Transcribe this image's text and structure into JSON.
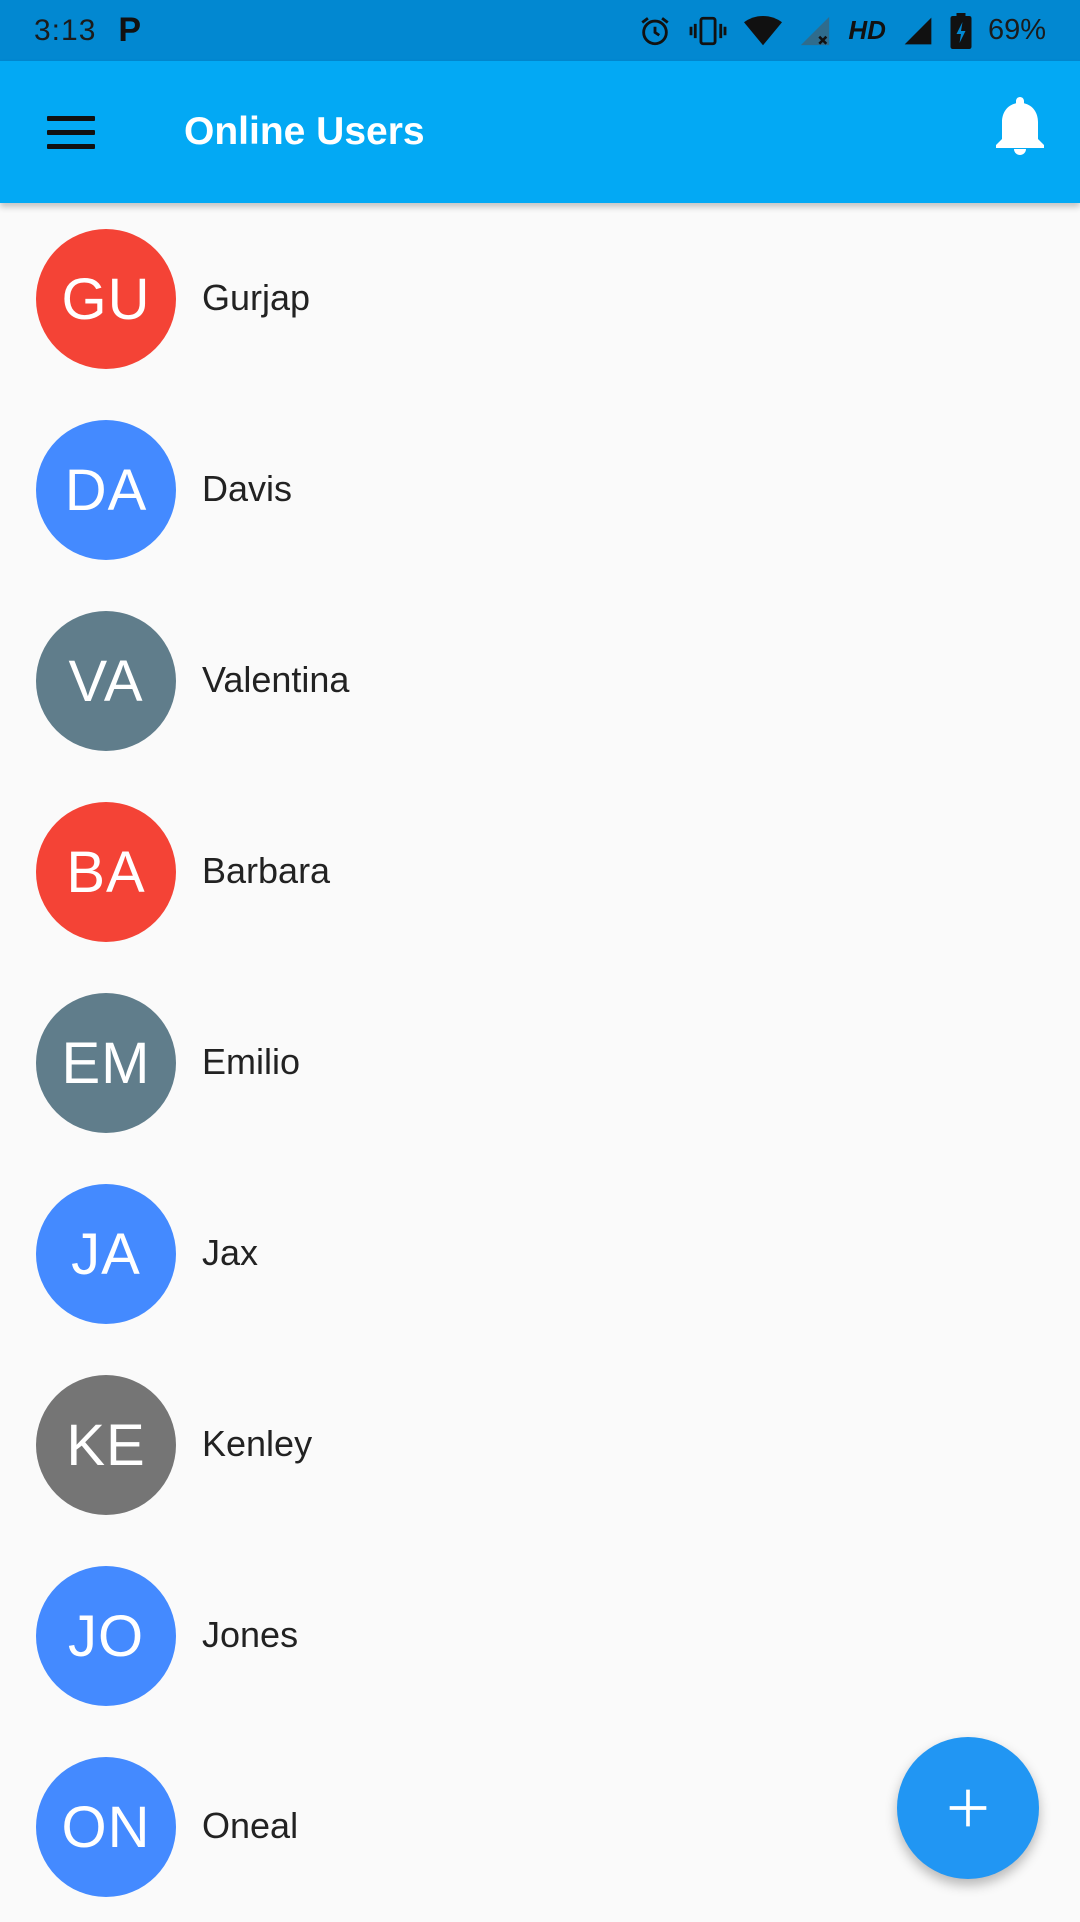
{
  "status_bar": {
    "time": "3:13",
    "notification_letter": "P",
    "network_label": "HD",
    "battery_text": "69%",
    "icons": [
      "alarm-icon",
      "vibrate-icon",
      "wifi-icon",
      "signal-off-icon",
      "signal-icon",
      "battery-charging-icon"
    ]
  },
  "app_bar": {
    "title": "Online Users",
    "menu_icon": "menu-icon",
    "bell_icon": "bell-icon",
    "background": "#03a9f4"
  },
  "users": [
    {
      "initials": "GU",
      "name": "Gurjap",
      "color": "#f44336"
    },
    {
      "initials": "DA",
      "name": "Davis",
      "color": "#448aff"
    },
    {
      "initials": "VA",
      "name": "Valentina",
      "color": "#607d8b"
    },
    {
      "initials": "BA",
      "name": "Barbara",
      "color": "#f44336"
    },
    {
      "initials": "EM",
      "name": "Emilio",
      "color": "#607d8b"
    },
    {
      "initials": "JA",
      "name": "Jax",
      "color": "#448aff"
    },
    {
      "initials": "KE",
      "name": "Kenley",
      "color": "#757575"
    },
    {
      "initials": "JO",
      "name": "Jones",
      "color": "#448aff"
    },
    {
      "initials": "ON",
      "name": "Oneal",
      "color": "#448aff"
    }
  ],
  "fab": {
    "icon": "plus-icon",
    "color": "#2196f3"
  }
}
